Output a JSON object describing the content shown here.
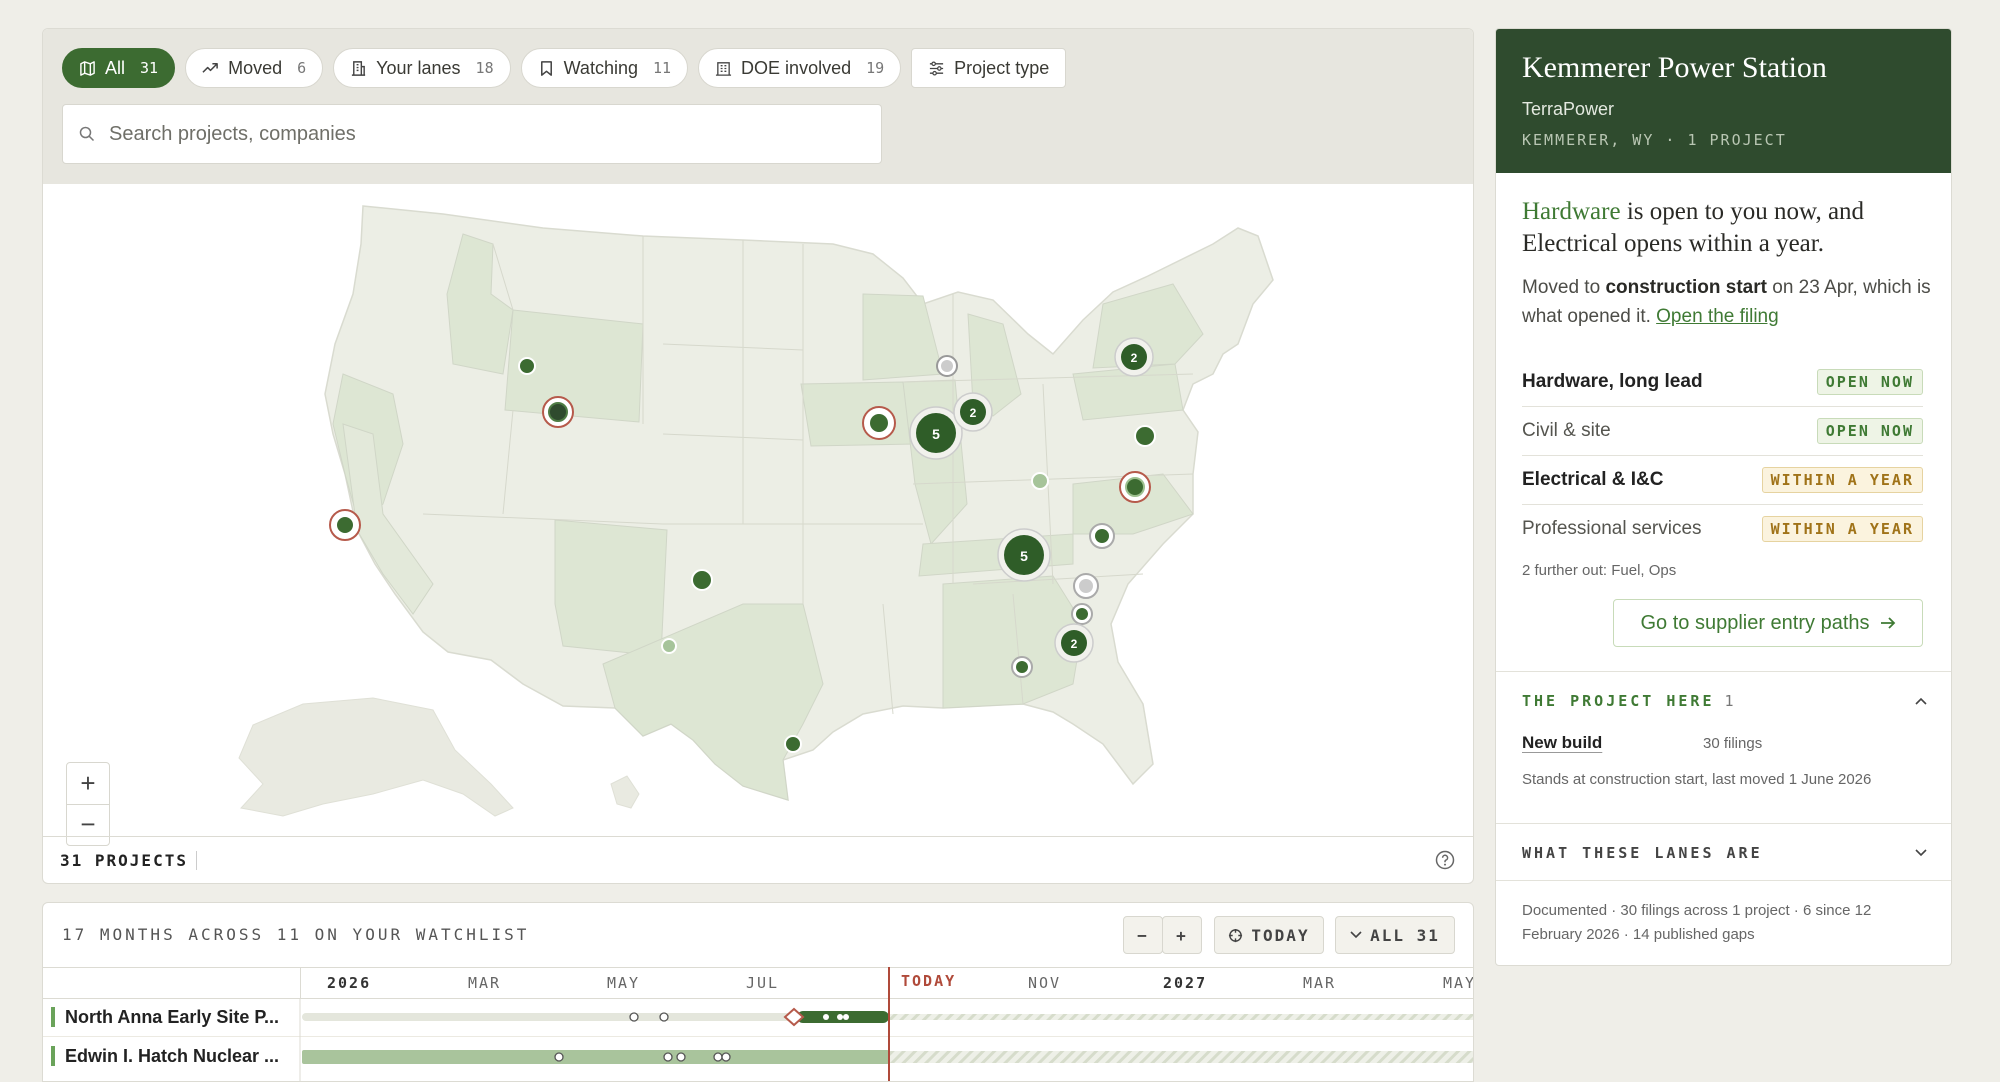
{
  "filters": {
    "chips": [
      {
        "label": "All",
        "count": "31",
        "icon": "map-icon"
      },
      {
        "label": "Moved",
        "count": "6",
        "icon": "trending-up-icon"
      },
      {
        "label": "Your lanes",
        "count": "18",
        "icon": "building-icon"
      },
      {
        "label": "Watching",
        "count": "11",
        "icon": "bookmark-icon"
      },
      {
        "label": "DOE involved",
        "count": "19",
        "icon": "government-icon"
      }
    ],
    "project_type_label": "Project type",
    "search_placeholder": "Search projects, companies"
  },
  "map": {
    "markers": [
      {
        "count": "2"
      },
      {
        "count": "5"
      },
      {
        "count": "2"
      },
      {
        "count": "5"
      },
      {
        "count": "2"
      }
    ],
    "zoom_in": "+",
    "zoom_out": "−",
    "projects_count": "31 PROJECTS"
  },
  "timeline": {
    "title": "17 MONTHS ACROSS 11 ON YOUR WATCHLIST",
    "today_button": "TODAY",
    "all_button": "ALL 31",
    "zoom_out": "−",
    "zoom_in": "+",
    "months": [
      "2026",
      "MAR",
      "MAY",
      "JUL",
      "TODAY",
      "NOV",
      "2027",
      "MAR",
      "MAY"
    ],
    "rows": [
      {
        "name": "North Anna Early Site P..."
      },
      {
        "name": "Edwin I. Hatch Nuclear ..."
      }
    ]
  },
  "detail": {
    "title": "Kemmerer Power Station",
    "company": "TerraPower",
    "location": "KEMMERER, WY · 1 PROJECT",
    "headline_highlight": "Hardware",
    "headline_rest": " is open to you now, and Electrical opens within a year.",
    "moved_prefix": "Moved to ",
    "moved_bold": "construction start",
    "moved_suffix": " on 23 Apr, which is what opened it. ",
    "moved_link": "Open the filing",
    "lanes": [
      {
        "name": "Hardware, long lead",
        "status": "OPEN NOW",
        "kind": "open",
        "emphasis": "strong"
      },
      {
        "name": "Civil & site",
        "status": "OPEN NOW",
        "kind": "open",
        "emphasis": "soft"
      },
      {
        "name": "Electrical & I&C",
        "status": "WITHIN A YEAR",
        "kind": "year",
        "emphasis": "strong"
      },
      {
        "name": "Professional services",
        "status": "WITHIN A YEAR",
        "kind": "year",
        "emphasis": "soft"
      }
    ],
    "further": "2 further out: Fuel, Ops",
    "supplier_button": "Go to supplier entry paths",
    "project_here_label": "THE PROJECT HERE",
    "project_here_count": "1",
    "project_type": "New build",
    "project_filings": "30 filings",
    "project_status": "Stands at construction start, last moved 1 June 2026",
    "lanes_section_label": "WHAT THESE LANES ARE",
    "documented": "Documented · 30 filings across 1 project · 6 since 12 February 2026 · 14 published gaps"
  },
  "colors": {
    "brand_green": "#3c6b31",
    "header_green": "#2f4b2e",
    "open_badge": "#3f7a34",
    "year_badge": "#a07319",
    "today_line": "#b04a3a"
  }
}
